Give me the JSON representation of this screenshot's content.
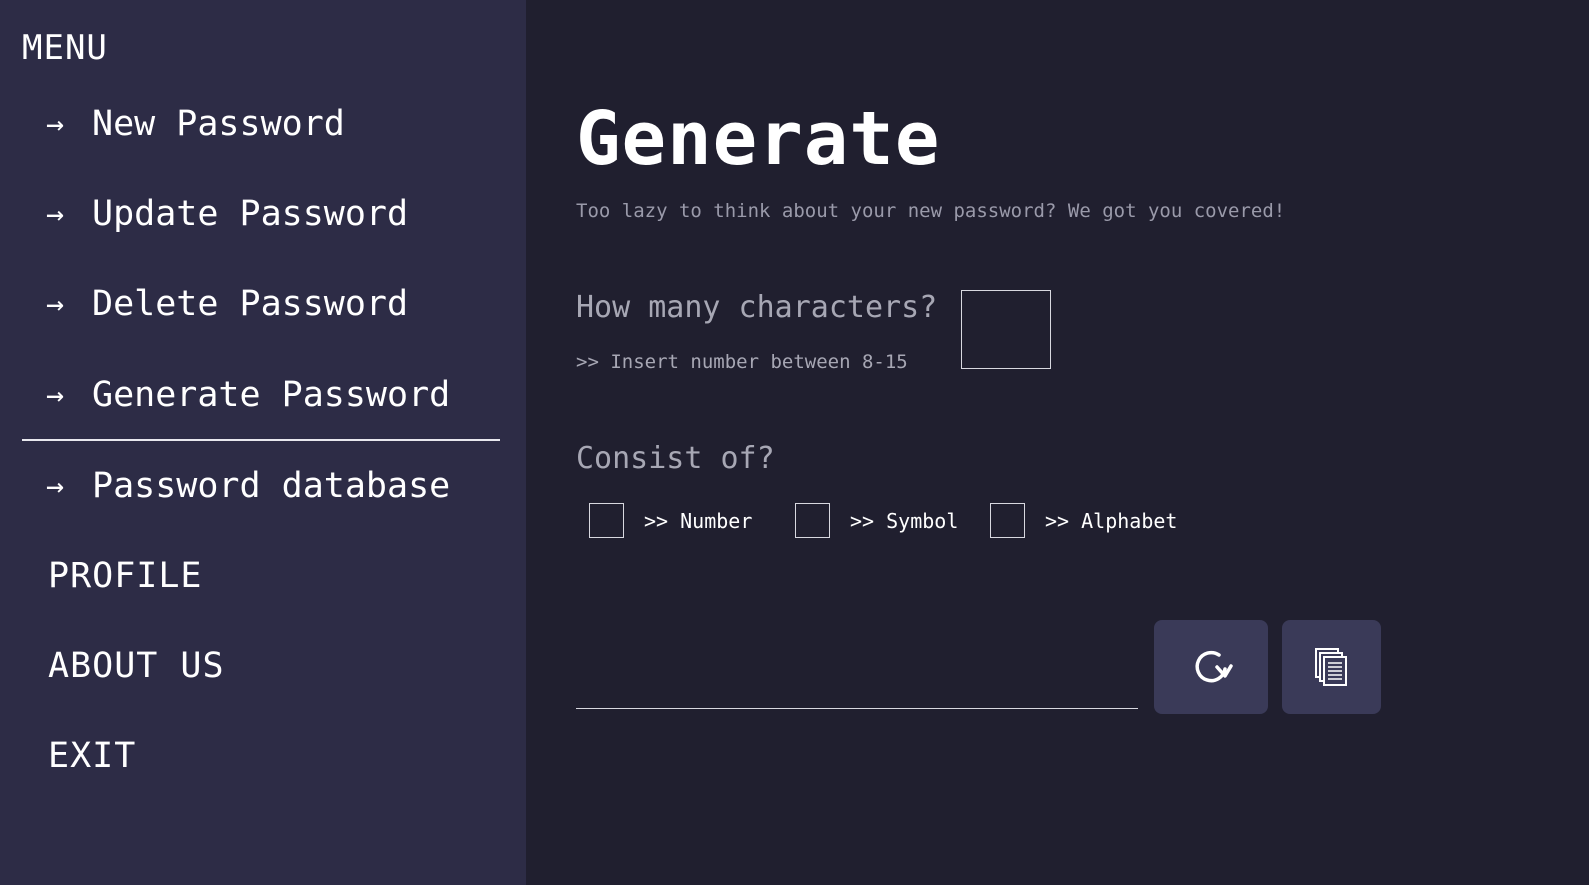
{
  "sidebar": {
    "menu_title": "MENU",
    "items": [
      {
        "label": "New Password"
      },
      {
        "label": "Update Password"
      },
      {
        "label": "Delete Password"
      },
      {
        "label": "Generate Password",
        "active": true
      },
      {
        "label": "Password database"
      }
    ],
    "arrow_glyph": "→",
    "profile": "PROFILE",
    "about": "ABOUT US",
    "exit": "EXIT"
  },
  "main": {
    "title": "Generate",
    "subtitle": "Too lazy to think about your new password? We got you covered!",
    "length_question": "How many characters?",
    "length_hint": ">> Insert number between 8-15",
    "length_value": "",
    "consist_label": "Consist of?",
    "options": [
      {
        "label": ">> Number",
        "checked": false
      },
      {
        "label": ">> Symbol",
        "checked": false
      },
      {
        "label": ">> Alphabet",
        "checked": false
      }
    ],
    "result_value": "",
    "refresh_icon": "refresh-icon",
    "copy_icon": "copy-icon"
  },
  "colors": {
    "background": "#201f2f",
    "sidebar": "#2d2c46",
    "button": "#3a3a58",
    "muted_text": "#a7a7b4"
  }
}
